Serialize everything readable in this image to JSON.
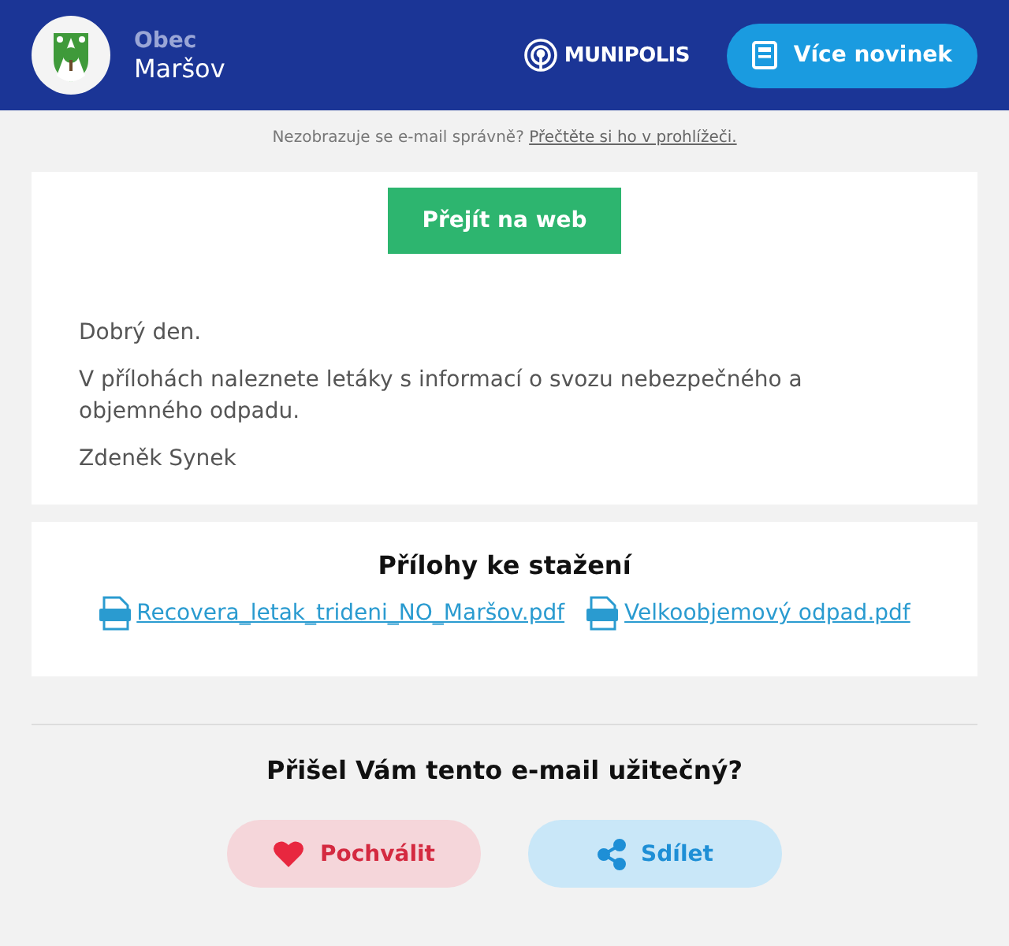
{
  "header": {
    "municipality_label": "Obec",
    "municipality_name": "Maršov",
    "brand": "MUNIPOLIS",
    "more_news_button": "Více novinek"
  },
  "notice": {
    "text": "Nezobrazuje se e-mail správně?",
    "link": "Přečtěte si ho v prohlížeči."
  },
  "message": {
    "button": "Přejít na web",
    "paragraphs": [
      "Dobrý den.",
      "V přílohách naleznete letáky s informací o svozu nebezpečného a objemného odpadu.",
      "Zdeněk Synek"
    ]
  },
  "attachments": {
    "title": "Přílohy ke stažení",
    "files": [
      "Recovera_letak_trideni_NO_Maršov.pdf",
      "Velkoobjemový odpad.pdf"
    ]
  },
  "feedback": {
    "question": "Přišel Vám tento e-mail užitečný?",
    "buttons": [
      {
        "kind": "praise",
        "label": "Pochválit"
      },
      {
        "kind": "share",
        "label": "Sdílet"
      }
    ]
  }
}
